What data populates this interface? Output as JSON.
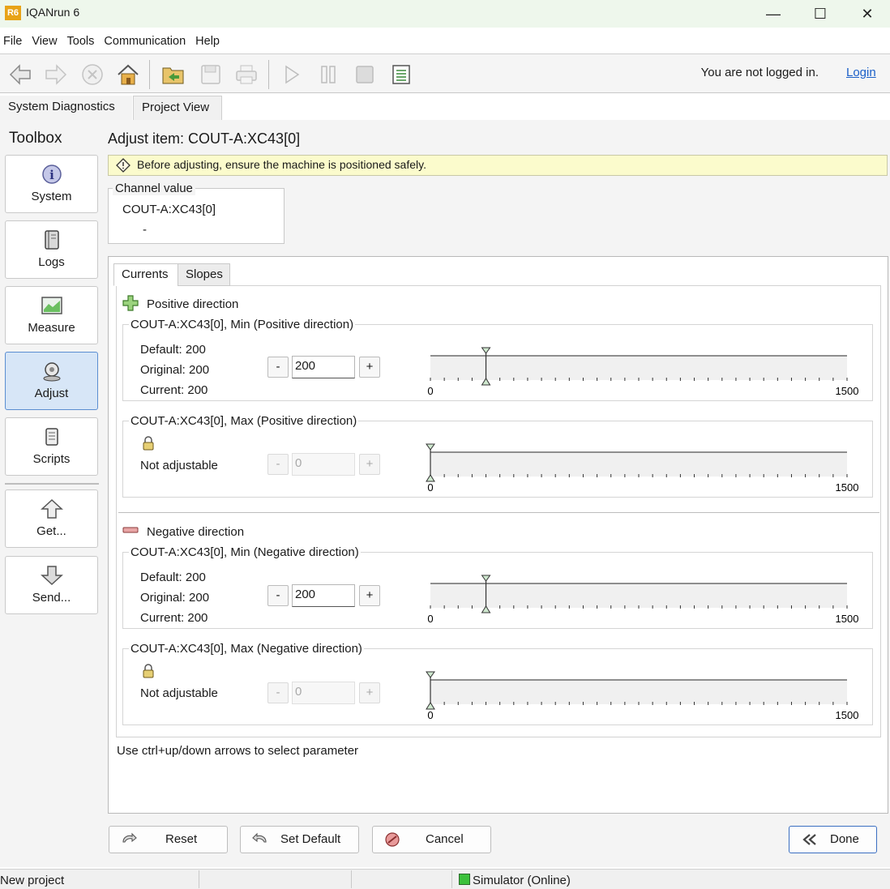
{
  "window": {
    "title": "IQANrun 6",
    "app_badge": "R6",
    "minimize": "—",
    "maximize": "☐",
    "close": "✕"
  },
  "menu": [
    "File",
    "View",
    "Tools",
    "Communication",
    "Help"
  ],
  "toolbar": {
    "icons": [
      "back-icon",
      "forward-icon",
      "stop-icon",
      "home-icon",
      "open-project-icon",
      "save-icon",
      "print-icon",
      "play-icon",
      "pause-icon",
      "record-icon",
      "report-icon"
    ],
    "login_note": "You are not logged in.",
    "login_link": "Login"
  },
  "top_tabs": [
    "System Diagnostics",
    "Project View"
  ],
  "toolbox": {
    "title": "Toolbox",
    "items": [
      {
        "label": "System",
        "icon": "info-icon",
        "active": false
      },
      {
        "label": "Logs",
        "icon": "logbook-icon",
        "active": false
      },
      {
        "label": "Measure",
        "icon": "chart-icon",
        "active": false
      },
      {
        "label": "Adjust",
        "icon": "adjust-knob-icon",
        "active": true
      },
      {
        "label": "Scripts",
        "icon": "script-icon",
        "active": false
      },
      {
        "label": "Get...",
        "icon": "arrow-up-icon",
        "active": false
      },
      {
        "label": "Send...",
        "icon": "arrow-down-icon",
        "active": false
      }
    ]
  },
  "adjust": {
    "title": "Adjust item: COUT-A:XC43[0]",
    "warning": "Before adjusting, ensure the machine is positioned safely.",
    "channel": {
      "legend": "Channel value",
      "name": "COUT-A:XC43[0]",
      "value": "-"
    },
    "tabs": [
      "Currents",
      "Slopes"
    ],
    "positive": {
      "label": "Positive direction",
      "min": {
        "legend": "COUT-A:XC43[0], Min (Positive direction)",
        "default": "Default: 200",
        "original": "Original: 200",
        "current": "Current: 200",
        "value": "200",
        "minus": "-",
        "plus": "+",
        "range_min": "0",
        "range_max": "1500",
        "slider_value": 200
      },
      "max": {
        "legend": "COUT-A:XC43[0], Max (Positive direction)",
        "status": "Not adjustable",
        "value": "0",
        "minus": "-",
        "plus": "+",
        "range_min": "0",
        "range_max": "1500",
        "slider_value": 0
      }
    },
    "negative": {
      "label": "Negative direction",
      "min": {
        "legend": "COUT-A:XC43[0], Min (Negative direction)",
        "default": "Default: 200",
        "original": "Original: 200",
        "current": "Current: 200",
        "value": "200",
        "minus": "-",
        "plus": "+",
        "range_min": "0",
        "range_max": "1500",
        "slider_value": 200
      },
      "max": {
        "legend": "COUT-A:XC43[0], Max (Negative direction)",
        "status": "Not adjustable",
        "value": "0",
        "minus": "-",
        "plus": "+",
        "range_min": "0",
        "range_max": "1500",
        "slider_value": 0
      }
    },
    "hint": "Use ctrl+up/down arrows to select parameter"
  },
  "buttons": {
    "reset": "Reset",
    "set_default": "Set Default",
    "cancel": "Cancel",
    "done": "Done"
  },
  "status": {
    "project": "New project",
    "connection": "Simulator (Online)",
    "online_color": "#3cc13c"
  }
}
